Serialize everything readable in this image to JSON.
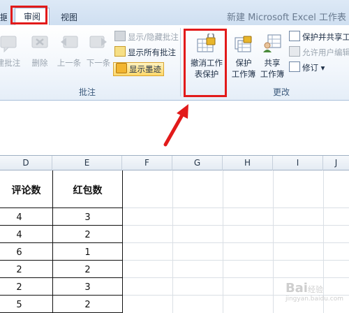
{
  "window": {
    "title": "新建 Microsoft Excel 工作表"
  },
  "tabs": [
    {
      "label": "据"
    },
    {
      "label": "审阅"
    },
    {
      "label": "视图"
    }
  ],
  "ribbon": {
    "comments_group": {
      "label": "批注",
      "buttons": [
        {
          "label": "建批注"
        },
        {
          "label": "删除"
        },
        {
          "label": "上一条"
        },
        {
          "label": "下一条"
        }
      ],
      "small": [
        {
          "label": "显示/隐藏批注"
        },
        {
          "label": "显示所有批注"
        },
        {
          "label": "显示墨迹"
        }
      ]
    },
    "changes_group": {
      "label": "更改",
      "buttons": [
        {
          "label": "撤消工作\n表保护"
        },
        {
          "label": "保护\n工作簿"
        },
        {
          "label": "共享\n工作簿"
        }
      ],
      "small": [
        {
          "label": "保护并共享工"
        },
        {
          "label": "允许用户编辑"
        },
        {
          "label": "修订 ▾"
        }
      ]
    }
  },
  "sheet": {
    "columns": [
      "D",
      "E",
      "F",
      "G",
      "H",
      "I",
      "J"
    ],
    "headers": [
      "评论数",
      "红包数"
    ],
    "rows": [
      [
        "4",
        "3"
      ],
      [
        "4",
        "2"
      ],
      [
        "6",
        "1"
      ],
      [
        "2",
        "2"
      ],
      [
        "2",
        "3"
      ],
      [
        "5",
        "2"
      ]
    ]
  },
  "watermark": {
    "text": "Bai",
    "sub": "经验",
    "domain": "jingyan.baidu.com"
  },
  "colors": {
    "highlight": "#e21a1a",
    "ribbon_border": "#9db6d4"
  }
}
